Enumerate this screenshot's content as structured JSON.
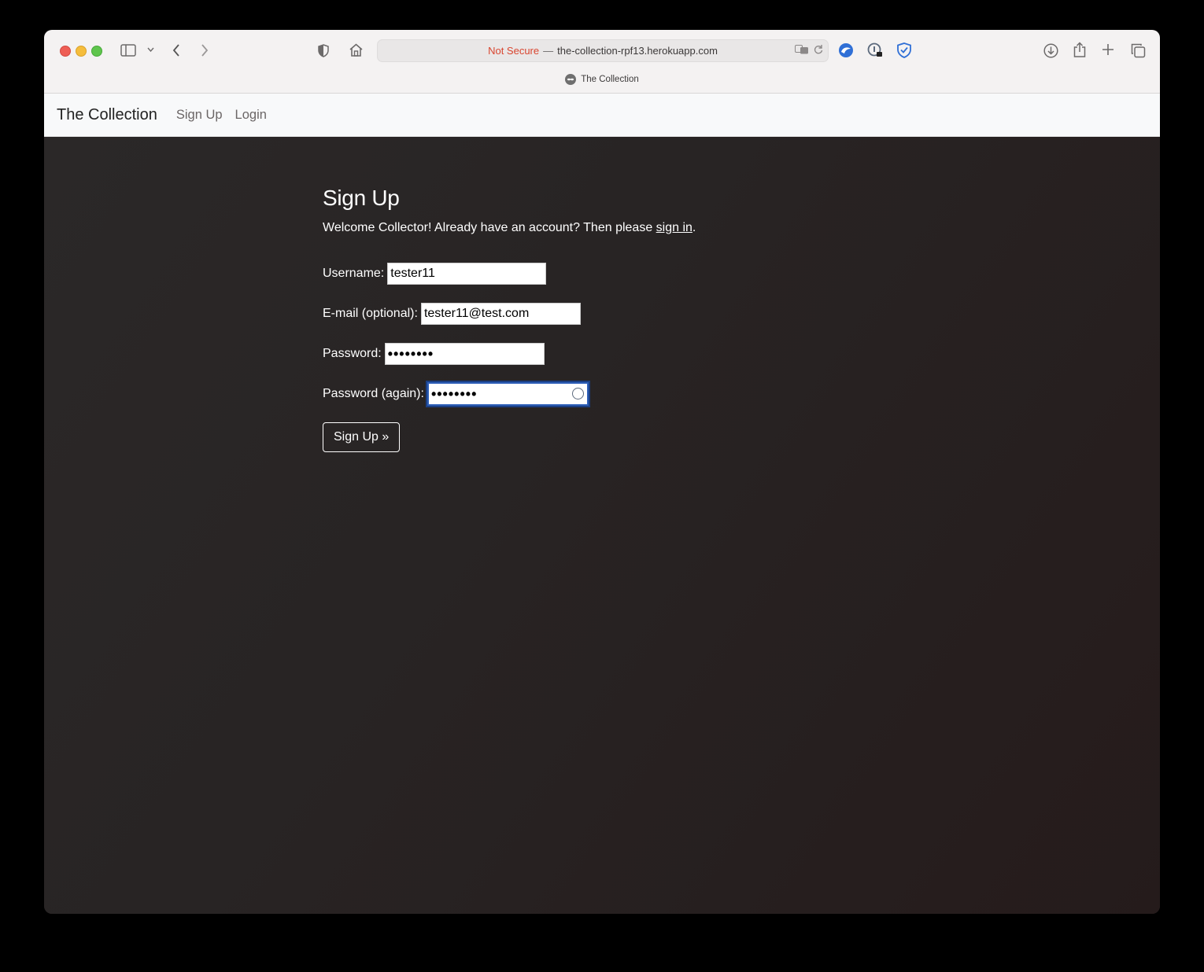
{
  "browser": {
    "address": {
      "security_label": "Not Secure",
      "separator": "—",
      "domain": "the-collection-rpf13.herokuapp.com"
    },
    "tab": {
      "title": "The Collection",
      "favicon": "alien-icon"
    },
    "toolbar_icons": [
      "sidebar-icon",
      "chevron-down-icon",
      "back-icon",
      "forward-icon",
      "shield-icon",
      "home-icon",
      "translate-icon",
      "reload-icon",
      "extension-icon",
      "password-key-icon",
      "adblock-shield-icon",
      "download-icon",
      "share-icon",
      "new-tab-icon",
      "tab-overview-icon"
    ]
  },
  "navbar": {
    "brand": "The Collection",
    "links": [
      "Sign Up",
      "Login"
    ]
  },
  "signup": {
    "title": "Sign Up",
    "intro_prefix": "Welcome Collector! Already have an account? Then please ",
    "intro_link": "sign in",
    "intro_suffix": ".",
    "fields": {
      "username": {
        "label": "Username:",
        "value": "tester11"
      },
      "email": {
        "label": "E-mail (optional):",
        "value": "tester11@test.com"
      },
      "password": {
        "label": "Password:",
        "value": "••••••••"
      },
      "password2": {
        "label": "Password (again):",
        "value": "••••••••"
      }
    },
    "submit_label": "Sign Up »"
  },
  "colors": {
    "background": "#2a2424",
    "navbar": "#f8f9fa",
    "not_secure": "#d9452f",
    "focus_ring": "#2e5fb8"
  }
}
